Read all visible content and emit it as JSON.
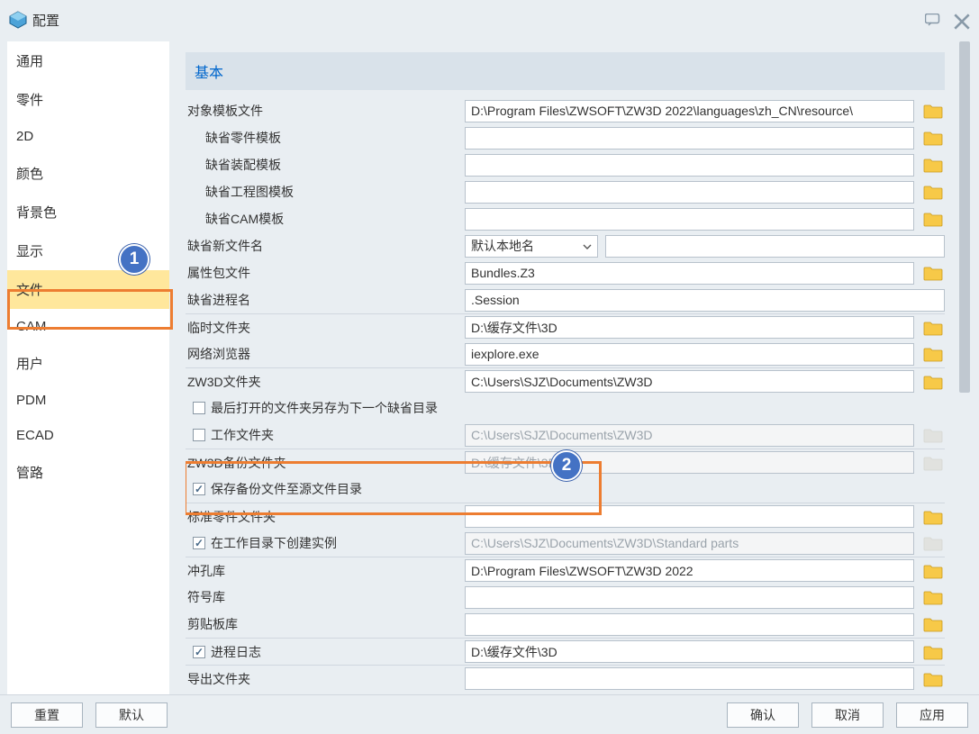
{
  "title": "配置",
  "annotations": {
    "badge1": "1",
    "badge2": "2"
  },
  "sidebar": {
    "items": [
      {
        "label": "通用"
      },
      {
        "label": "零件"
      },
      {
        "label": "2D"
      },
      {
        "label": "颜色"
      },
      {
        "label": "背景色"
      },
      {
        "label": "显示"
      },
      {
        "label": "文件"
      },
      {
        "label": "CAM"
      },
      {
        "label": "用户"
      },
      {
        "label": "PDM"
      },
      {
        "label": "ECAD"
      },
      {
        "label": "管路"
      }
    ],
    "selected_index": 6
  },
  "section": {
    "title": "基本",
    "rows": [
      {
        "kind": "text",
        "label": "对象模板文件",
        "value": "D:\\Program Files\\ZWSOFT\\ZW3D 2022\\languages\\zh_CN\\resource\\",
        "browse": true
      },
      {
        "kind": "text",
        "label": "缺省零件模板",
        "indent": true,
        "value": "",
        "browse": true
      },
      {
        "kind": "text",
        "label": "缺省装配模板",
        "indent": true,
        "value": "",
        "browse": true
      },
      {
        "kind": "text",
        "label": "缺省工程图模板",
        "indent": true,
        "value": "",
        "browse": true
      },
      {
        "kind": "text",
        "label": "缺省CAM模板",
        "indent": true,
        "value": "",
        "browse": true
      },
      {
        "kind": "combo",
        "label": "缺省新文件名",
        "combo_value": "默认本地名",
        "side_input": ""
      },
      {
        "kind": "text",
        "label": "属性包文件",
        "value": "Bundles.Z3",
        "browse": true
      },
      {
        "kind": "text",
        "label": "缺省进程名",
        "value": ".Session"
      },
      {
        "kind": "text",
        "label": "临时文件夹",
        "value": "D:\\缓存文件\\3D",
        "browse": true,
        "divider": true
      },
      {
        "kind": "text",
        "label": "网络浏览器",
        "value": "iexplore.exe",
        "browse": true
      },
      {
        "kind": "text",
        "label": "ZW3D文件夹",
        "value": "C:\\Users\\SJZ\\Documents\\ZW3D",
        "browse": true,
        "divider": true
      },
      {
        "kind": "check",
        "label": "最后打开的文件夹另存为下一个缺省目录",
        "checked": false
      },
      {
        "kind": "check_text",
        "label": "工作文件夹",
        "checked": false,
        "value": "C:\\Users\\SJZ\\Documents\\ZW3D",
        "disabled": true,
        "browse": true
      },
      {
        "kind": "text",
        "label": "ZW3D备份文件夹",
        "value": "D:\\缓存文件\\3D",
        "disabled": true,
        "browse": true,
        "divider": true
      },
      {
        "kind": "check",
        "label": "保存备份文件至源文件目录",
        "checked": true
      },
      {
        "kind": "text",
        "label": "标准零件文件夹",
        "value": "",
        "browse": true,
        "divider": true
      },
      {
        "kind": "check_text",
        "label": "在工作目录下创建实例",
        "checked": true,
        "value": "C:\\Users\\SJZ\\Documents\\ZW3D\\Standard parts",
        "disabled": true,
        "browse": true
      },
      {
        "kind": "text",
        "label": "冲孔库",
        "value": "D:\\Program Files\\ZWSOFT\\ZW3D 2022",
        "browse": true,
        "divider": true
      },
      {
        "kind": "text",
        "label": "符号库",
        "value": "",
        "browse": true
      },
      {
        "kind": "text",
        "label": "剪贴板库",
        "value": "",
        "browse": true
      },
      {
        "kind": "check_text",
        "label": "进程日志",
        "checked": true,
        "value": "D:\\缓存文件\\3D",
        "browse": true,
        "divider": true
      },
      {
        "kind": "text",
        "label": "导出文件夹",
        "value": "",
        "browse": true,
        "divider": true
      }
    ]
  },
  "footer": {
    "reset": "重置",
    "defaults": "默认",
    "ok": "确认",
    "cancel": "取消",
    "apply": "应用"
  }
}
